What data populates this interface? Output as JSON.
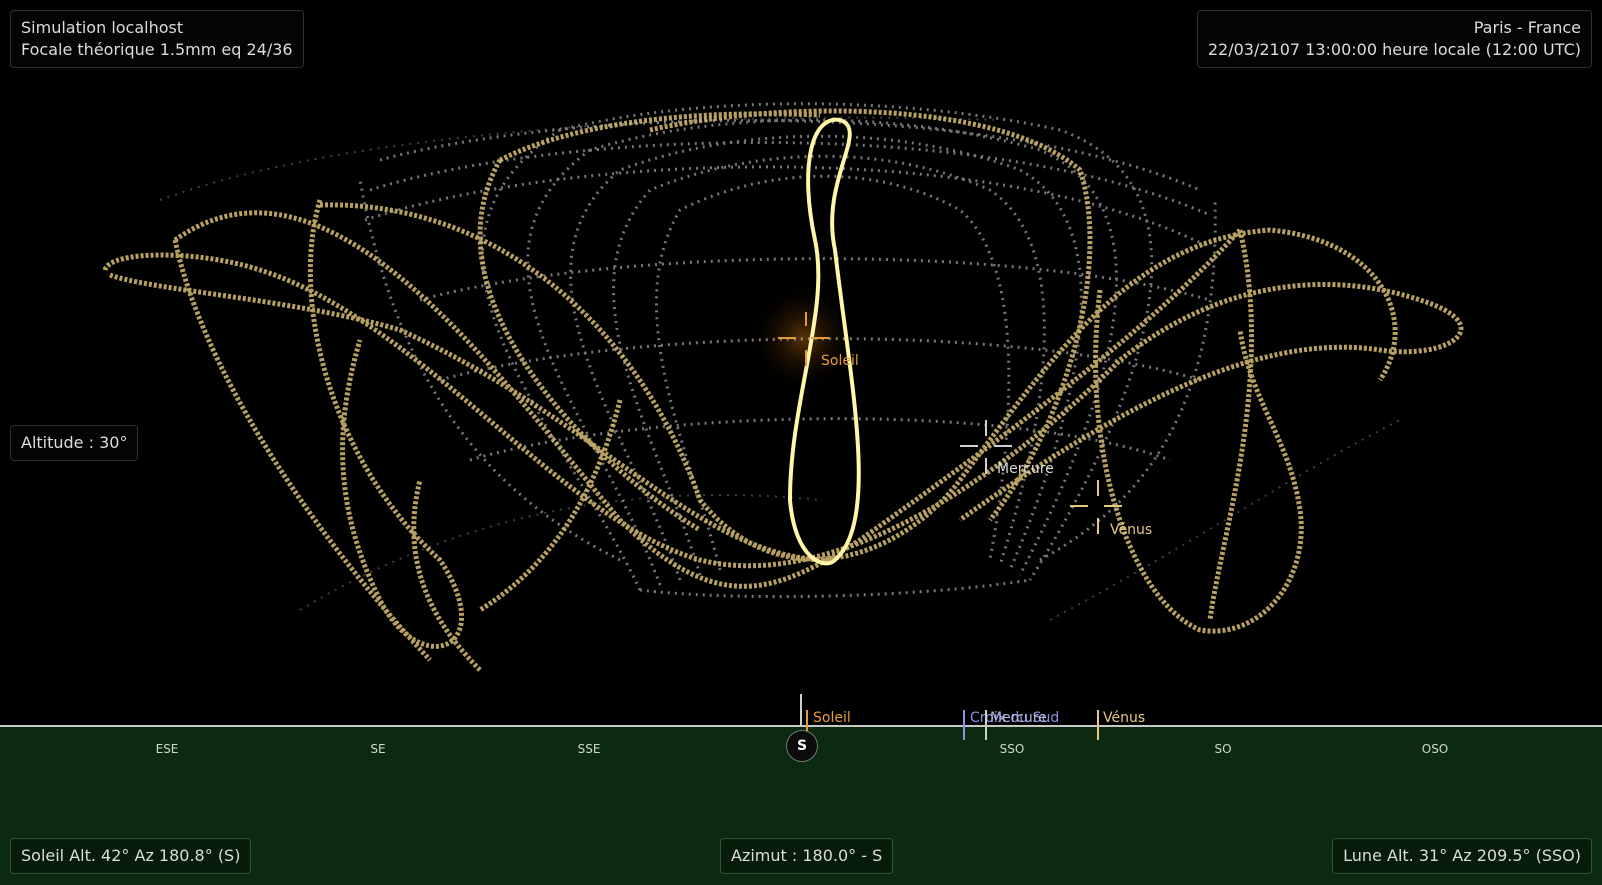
{
  "header": {
    "left_line1": "Simulation localhost",
    "left_line2": "Focale théorique 1.5mm eq 24/36",
    "right_line1": "Paris - France",
    "right_line2": "22/03/2107 13:00:00 heure locale (12:00 UTC)"
  },
  "altitude_label": "Altitude : 30°",
  "sky_labels": {
    "sun": "Soleil",
    "mercury": "Mercure",
    "venus": "Vénus"
  },
  "horizon_markers": {
    "sun": "Soleil",
    "southern_cross": "Croix du Sud",
    "mercury": "Mercure",
    "venus": "Vénus"
  },
  "compass": [
    "ESE",
    "SE",
    "SSE",
    "SSO",
    "SO",
    "OSO"
  ],
  "south_badge": "S",
  "footer": {
    "sun_info": "Soleil Alt. 42° Az 180.8° (S)",
    "azimuth": "Azimut : 180.0° - S",
    "moon_info": "Lune Alt. 31° Az 209.5° (SSO)"
  },
  "colors": {
    "sun": "#e89a3c",
    "mercury": "#cfcfcf",
    "venus": "#e8c880",
    "southern_cross": "#8f8fe8",
    "ground": "#0c2a0f"
  },
  "icons": [
    "sun-crosshair-icon",
    "mercury-crosshair-icon",
    "venus-crosshair-icon"
  ]
}
